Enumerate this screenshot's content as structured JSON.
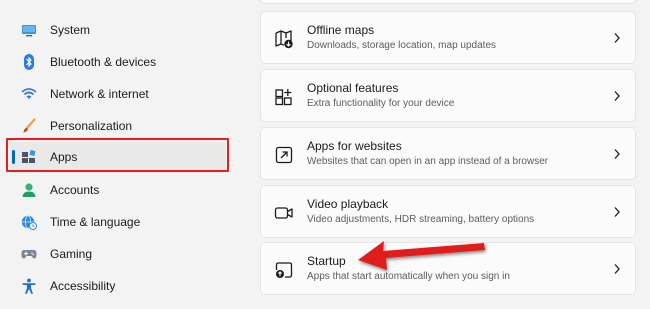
{
  "sidebar": {
    "items": [
      {
        "label": "System",
        "icon": "system-monitor-icon"
      },
      {
        "label": "Bluetooth & devices",
        "icon": "bluetooth-icon"
      },
      {
        "label": "Network & internet",
        "icon": "wifi-icon"
      },
      {
        "label": "Personalization",
        "icon": "brush-icon"
      },
      {
        "label": "Apps",
        "icon": "apps-icon",
        "selected": true
      },
      {
        "label": "Accounts",
        "icon": "person-icon"
      },
      {
        "label": "Time & language",
        "icon": "globe-clock-icon"
      },
      {
        "label": "Gaming",
        "icon": "gamepad-icon"
      },
      {
        "label": "Accessibility",
        "icon": "accessibility-icon"
      }
    ]
  },
  "cards": [
    {
      "title": "Offline maps",
      "desc": "Downloads, storage location, map updates",
      "icon": "map-download-icon"
    },
    {
      "title": "Optional features",
      "desc": "Extra functionality for your device",
      "icon": "grid-add-icon"
    },
    {
      "title": "Apps for websites",
      "desc": "Websites that can open in an app instead of a browser",
      "icon": "open-external-icon"
    },
    {
      "title": "Video playback",
      "desc": "Video adjustments, HDR streaming, battery options",
      "icon": "video-camera-icon"
    },
    {
      "title": "Startup",
      "desc": "Apps that start automatically when you sign in",
      "icon": "startup-icon"
    }
  ],
  "colors": {
    "accent": "#0067c0",
    "annotation": "#e41f1f"
  }
}
